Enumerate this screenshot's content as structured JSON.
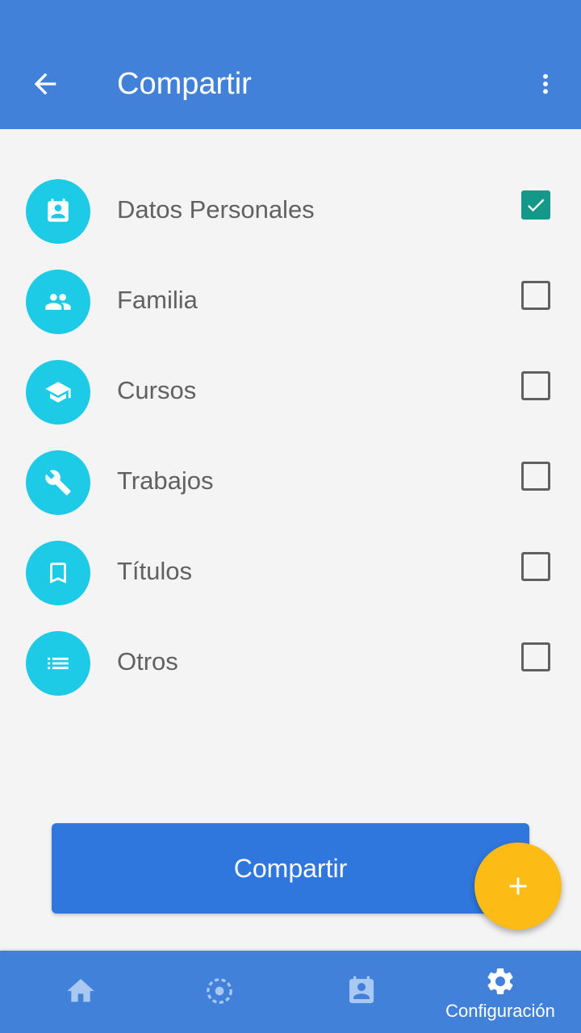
{
  "appbar": {
    "title": "Compartir",
    "back_icon": "arrow-back-icon",
    "more_icon": "more-vert-icon"
  },
  "items": [
    {
      "label": "Datos Personales",
      "icon": "contact-card-icon",
      "checked": true
    },
    {
      "label": "Familia",
      "icon": "people-icon",
      "checked": false
    },
    {
      "label": "Cursos",
      "icon": "school-icon",
      "checked": false
    },
    {
      "label": "Trabajos",
      "icon": "wrench-icon",
      "checked": false
    },
    {
      "label": "Títulos",
      "icon": "bookmark-icon",
      "checked": false
    },
    {
      "label": "Otros",
      "icon": "list-icon",
      "checked": false
    }
  ],
  "share_button": {
    "label": "Compartir"
  },
  "fab": {
    "icon": "plus-icon"
  },
  "bottom_nav": {
    "items": [
      {
        "icon": "home-icon",
        "label": "",
        "active": false
      },
      {
        "icon": "target-icon",
        "label": "",
        "active": false
      },
      {
        "icon": "contact-card-icon",
        "label": "",
        "active": false
      },
      {
        "icon": "gear-icon",
        "label": "Configuración",
        "active": true
      }
    ]
  },
  "colors": {
    "primary": "#4281d9",
    "button": "#2f77dc",
    "icon_circle": "#1ecbe6",
    "checkbox_checked": "#14988a",
    "fab": "#fdbb16"
  }
}
